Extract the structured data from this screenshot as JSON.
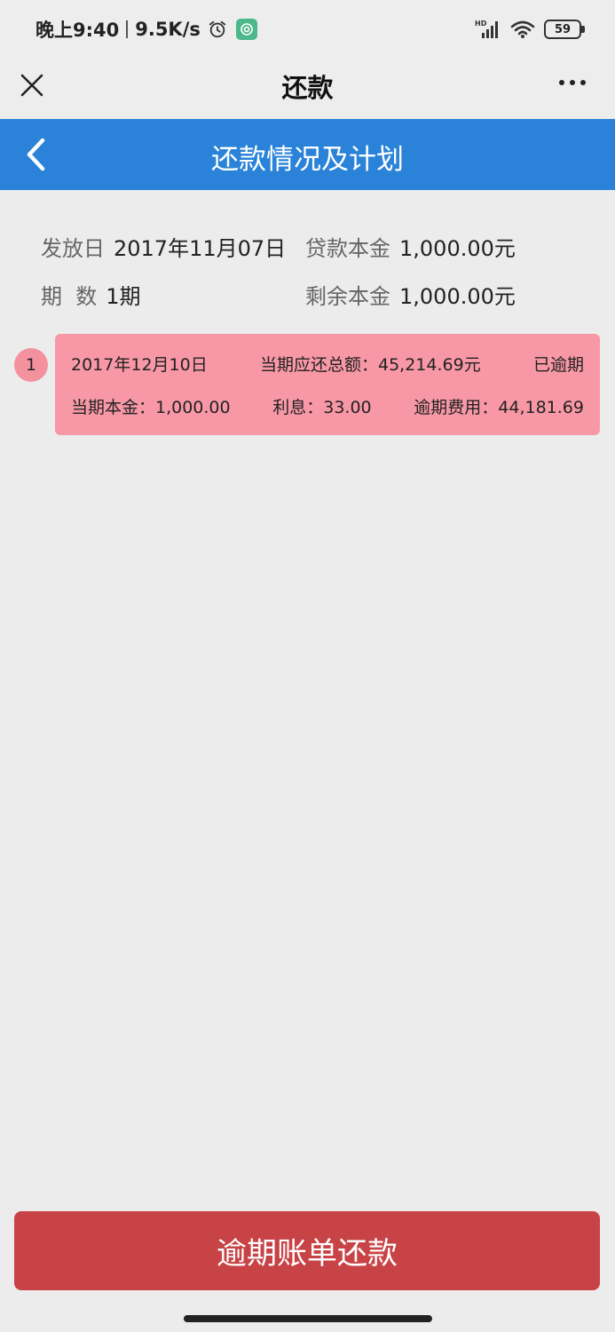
{
  "status_bar": {
    "time": "晚上9:40",
    "net_speed": "9.5K/s",
    "signal_badge": "HD",
    "battery": "59"
  },
  "title_bar": {
    "title": "还款"
  },
  "page_header": {
    "title": "还款情况及计划"
  },
  "loan_info": {
    "issue_date_label": "发放日",
    "issue_date": "2017年11月07日",
    "principal_label": "贷款本金",
    "principal": "1,000.00元",
    "periods_label": "期  数",
    "periods": "1期",
    "remaining_label": "剩余本金",
    "remaining": "1,000.00元"
  },
  "plan": {
    "items": [
      {
        "index": "1",
        "date": "2017年12月10日",
        "total_due": "当期应还总额：45,214.69元",
        "status": "已逾期",
        "principal": "当期本金：1,000.00",
        "interest": "利息：33.00",
        "overdue_fee": "逾期费用：44,181.69"
      }
    ]
  },
  "actions": {
    "repay_label": "逾期账单还款"
  },
  "colors": {
    "header_blue": "#2a83d8",
    "overdue_pink": "#f898a6",
    "button_red": "#c84346"
  }
}
